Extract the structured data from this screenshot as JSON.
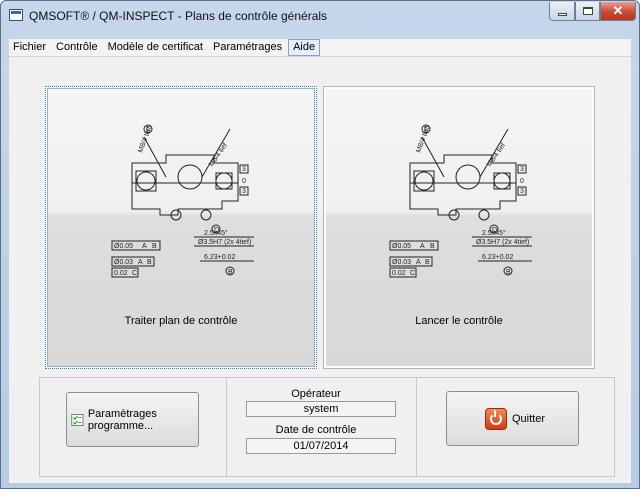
{
  "window": {
    "title": "QMSOFT® / QM-INSPECT - Plans de contrôle générals",
    "close_glyph": "✕"
  },
  "menu": [
    {
      "label": "Fichier"
    },
    {
      "label": "Contrôle"
    },
    {
      "label": "Modèle de certificat"
    },
    {
      "label": "Paramétrages"
    },
    {
      "label": "Aide"
    }
  ],
  "panels": {
    "left_label": "Traiter plan de contrôle",
    "right_label": "Lancer le contrôle"
  },
  "drawing": {
    "callouts": [
      "C",
      "D",
      "B",
      "A"
    ],
    "labels": [
      "M8/4 tief",
      "M8/4 tief"
    ],
    "box_numbers": [
      "3",
      "0",
      "3"
    ],
    "chamfer": "2.5x45°",
    "bore": "Ø3.5H7 (2x 4tief)",
    "dim_bottom": "6.23+0.02",
    "tol1": [
      "Ø0.05",
      "A",
      "B"
    ],
    "tol2": [
      "Ø0.03",
      "A",
      "B"
    ],
    "tol3": [
      "0.02",
      "C"
    ],
    "small_marks": [
      "4",
      "4",
      "A",
      "B"
    ]
  },
  "bottom": {
    "params_button": "Paramètrages programme...",
    "operator_label": "Opérateur",
    "operator_value": "system",
    "date_label": "Date de contrôle",
    "date_value": "01/07/2014",
    "quit_button": "Quitter"
  },
  "colors": {
    "accent_focus": "#3c7fb1",
    "quit_icon": "#d23b12"
  },
  "icons": {
    "params": "checklist-icon",
    "quit": "power-icon"
  }
}
